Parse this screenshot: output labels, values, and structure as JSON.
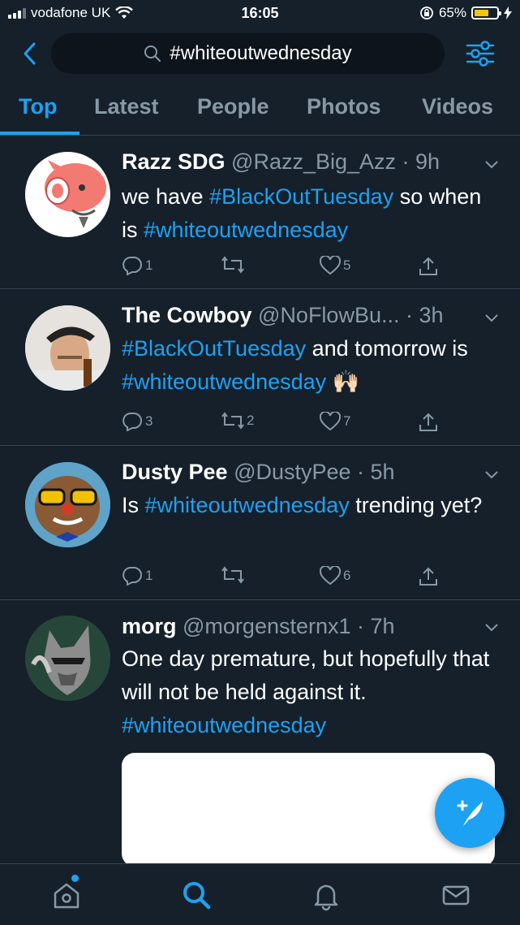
{
  "status_bar": {
    "carrier": "vodafone UK",
    "time": "16:05",
    "battery_percent": "65%",
    "battery_level": 0.65
  },
  "header": {
    "search_query": "#whiteoutwednesday"
  },
  "tabs": [
    {
      "label": "Top",
      "active": true
    },
    {
      "label": "Latest",
      "active": false
    },
    {
      "label": "People",
      "active": false
    },
    {
      "label": "Photos",
      "active": false
    },
    {
      "label": "Videos",
      "active": false
    }
  ],
  "tweets": [
    {
      "name": "Razz SDG",
      "meta": "@Razz_Big_Azz · 9h",
      "text_parts": [
        {
          "t": "we have "
        },
        {
          "t": "#BlackOutTuesday",
          "tag": true
        },
        {
          "t": " so when is "
        },
        {
          "t": "#whiteoutwednesday",
          "tag": true
        }
      ],
      "replies": "1",
      "retweets": "",
      "likes": "5"
    },
    {
      "name": "The Cowboy",
      "meta": "@NoFlowBu... · 3h",
      "text_parts": [
        {
          "t": "#BlackOutTuesday",
          "tag": true
        },
        {
          "t": " and tomorrow is "
        },
        {
          "t": "#whiteoutwednesday",
          "tag": true
        },
        {
          "t": " 🙌🏻"
        }
      ],
      "replies": "3",
      "retweets": "2",
      "likes": "7"
    },
    {
      "name": "Dusty Pee",
      "meta": "@DustyPee · 5h",
      "text_parts": [
        {
          "t": "Is "
        },
        {
          "t": "#whiteoutwednesday",
          "tag": true
        },
        {
          "t": " trending yet?"
        }
      ],
      "replies": "1",
      "retweets": "",
      "likes": "6"
    },
    {
      "name": "morg",
      "meta": "@morgensternx1 · 7h",
      "text_parts": [
        {
          "t": "One day premature, but hopefully that will not be held against it. "
        },
        {
          "t": "#whiteoutwednesday",
          "tag": true
        }
      ]
    }
  ],
  "colors": {
    "background": "#15202b",
    "accent": "#1da1f2",
    "muted": "#8899a6",
    "battery": "#f2c700"
  },
  "icons": [
    "signal-icon",
    "wifi-icon",
    "lock-rotation-icon",
    "battery-icon",
    "charging-icon",
    "back-icon",
    "search-icon",
    "filter-icon",
    "chevron-down-icon",
    "reply-icon",
    "retweet-icon",
    "like-icon",
    "share-icon",
    "compose-icon",
    "home-icon",
    "explore-icon",
    "notifications-icon",
    "messages-icon"
  ]
}
